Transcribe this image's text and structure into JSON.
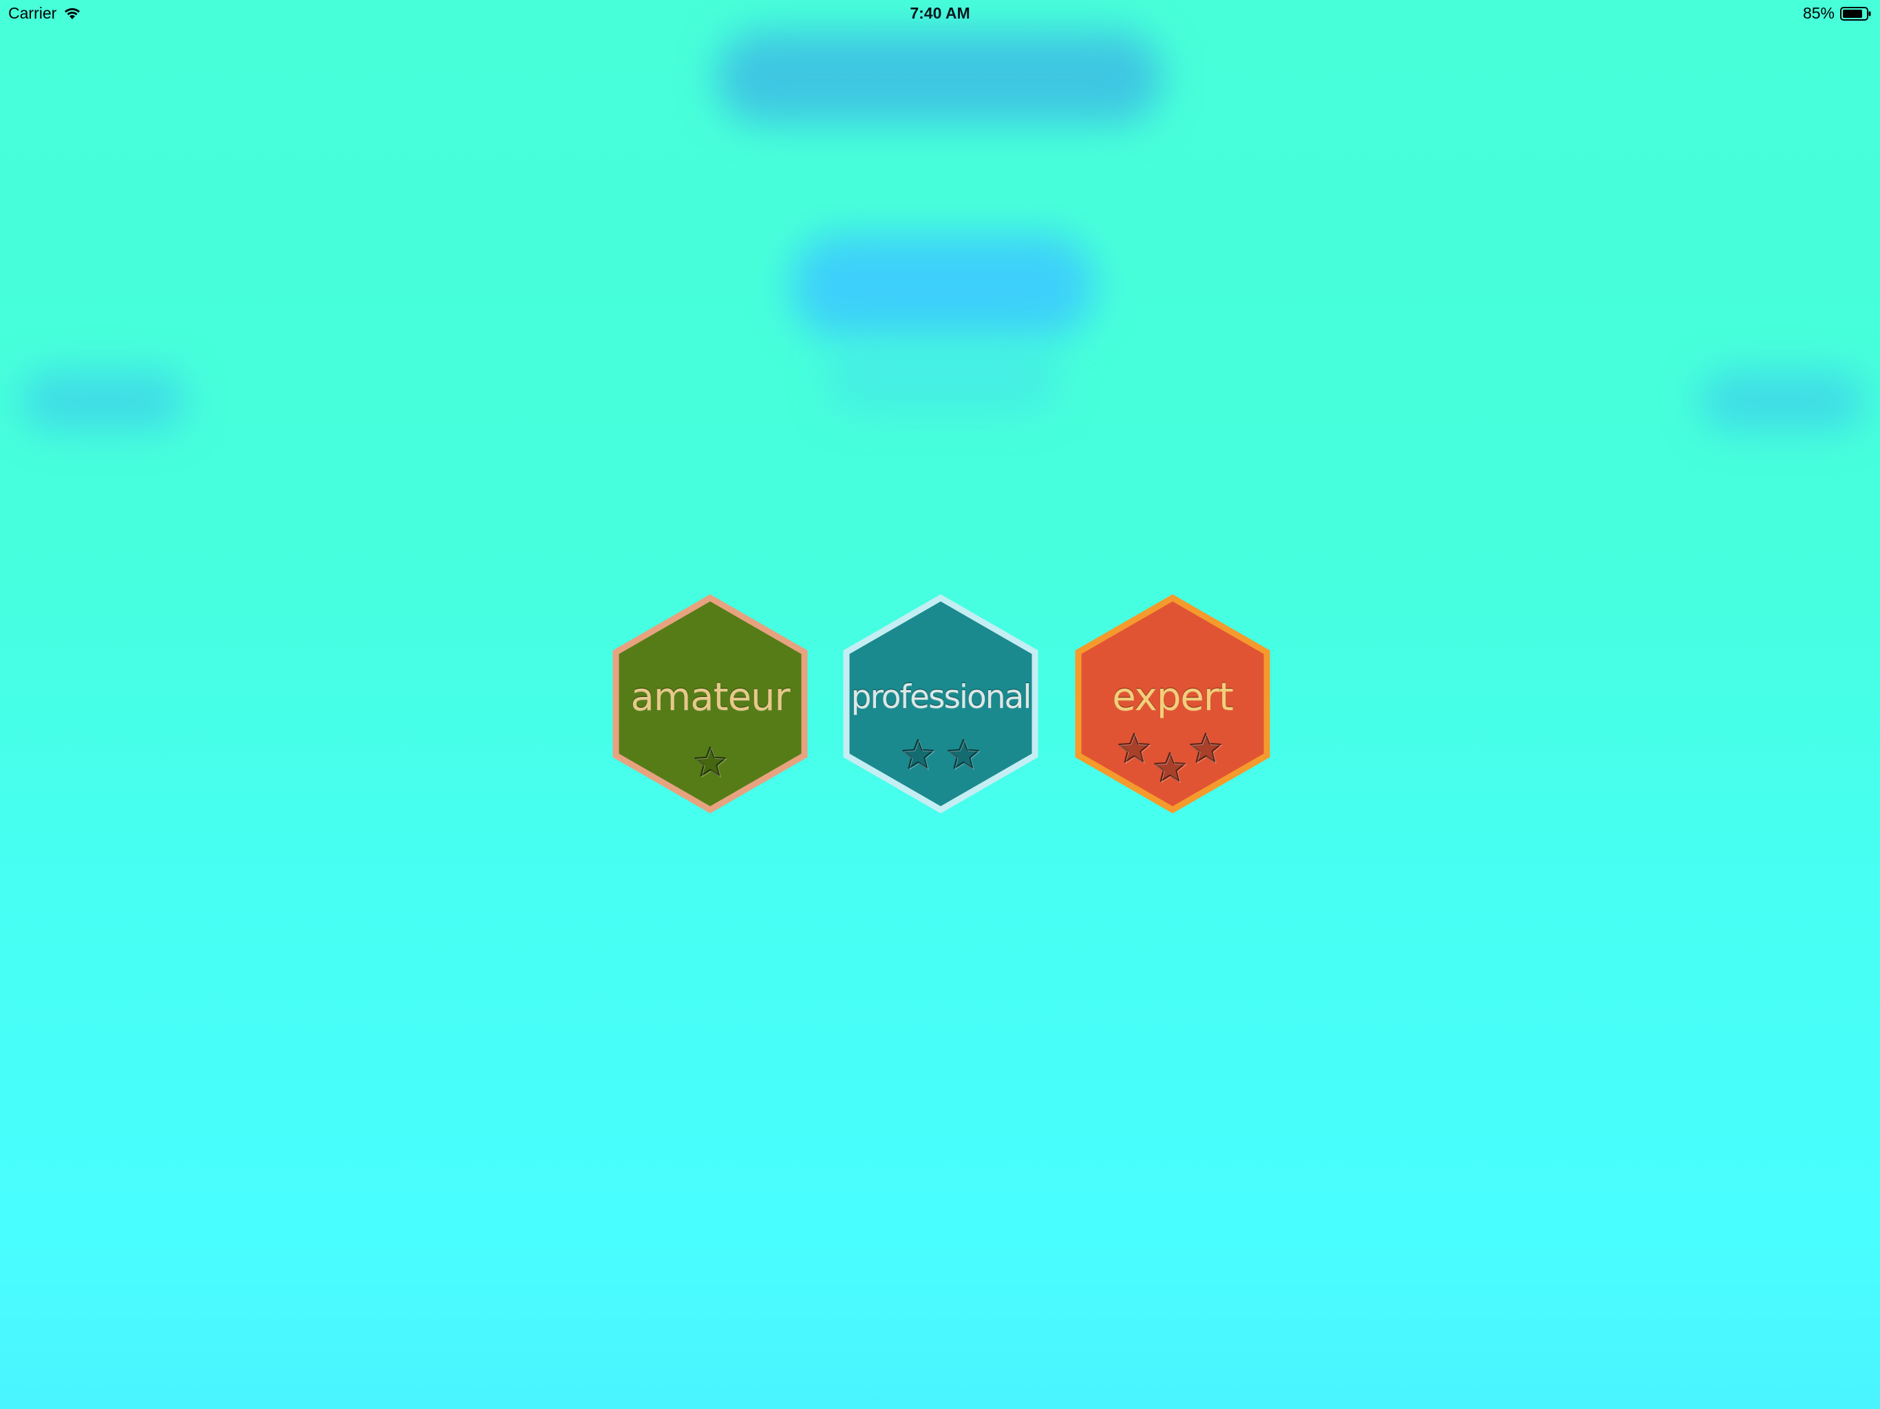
{
  "status_bar": {
    "carrier": "Carrier",
    "time": "7:40 AM",
    "battery_percent": "85%",
    "battery_level": 0.85,
    "icons": [
      "wifi-icon",
      "battery-icon"
    ]
  },
  "levels": [
    {
      "label": "amateur",
      "stars": 1,
      "fill_color": "#567c18",
      "border_color": "#e7a27f",
      "text_color": "#e7c98a",
      "star_color": "#46660f"
    },
    {
      "label": "professional",
      "stars": 2,
      "fill_color": "#1a8a8e",
      "border_color": "#c4eef3",
      "text_color": "#dde7e6",
      "star_color": "#146b70"
    },
    {
      "label": "expert",
      "stars": 3,
      "fill_color": "#e05433",
      "border_color": "#f59a2c",
      "text_color": "#f2cf7a",
      "star_color": "#a8402a"
    }
  ]
}
